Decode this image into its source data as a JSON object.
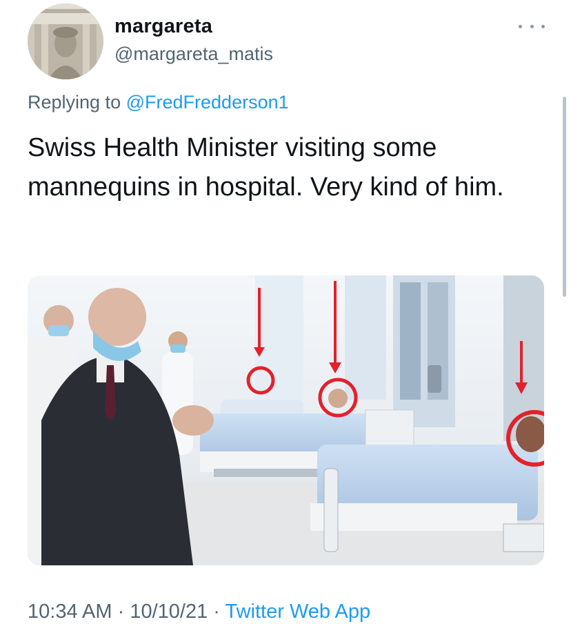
{
  "author": {
    "name": "margareta",
    "handle": "@margareta_matis",
    "avatar_icon": "avatar-statue-icon"
  },
  "reply": {
    "prefix": "Replying to",
    "mention": "@FredFredderson1"
  },
  "tweet": {
    "text": "Swiss Health Minister visiting some mannequins in hospital. Very kind of him."
  },
  "media": {
    "description_icon": "hospital-photo-icon",
    "annotation_color": "#e4212b"
  },
  "timestamp": {
    "time": "10:34 AM",
    "separator": "·",
    "date": "10/10/21",
    "source": "Twitter Web App"
  },
  "colors": {
    "link": "#1d9bf0",
    "secondary_text": "#536471",
    "primary_text": "#0f1419"
  }
}
